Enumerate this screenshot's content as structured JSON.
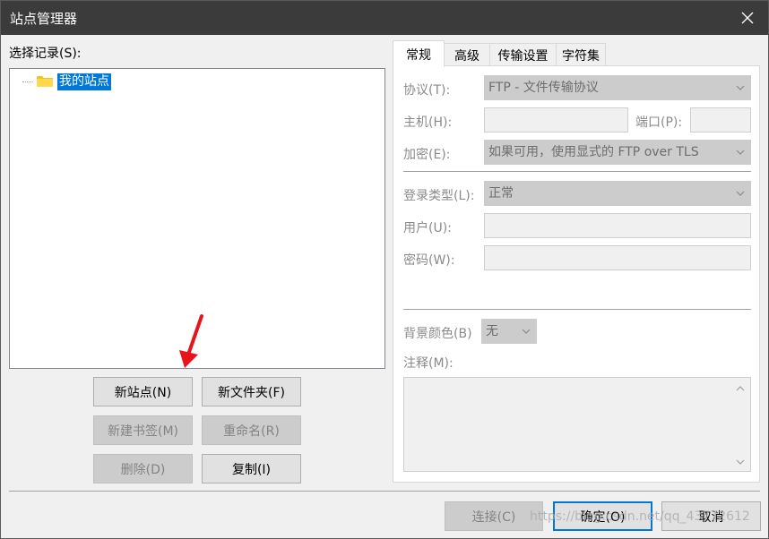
{
  "window": {
    "title": "站点管理器"
  },
  "tree": {
    "section_label": "选择记录(S):",
    "items": [
      {
        "label": "我的站点"
      }
    ]
  },
  "left_buttons": {
    "new_site": "新站点(N)",
    "new_folder": "新文件夹(F)",
    "new_bookmark": "新建书签(M)",
    "rename": "重命名(R)",
    "delete": "删除(D)",
    "duplicate": "复制(I)"
  },
  "tabs": [
    "常规",
    "高级",
    "传输设置",
    "字符集"
  ],
  "general": {
    "protocol_label": "协议(T):",
    "protocol_value": "FTP - 文件传输协议",
    "host_label": "主机(H):",
    "host_value": "",
    "port_label": "端口(P):",
    "port_value": "",
    "encryption_label": "加密(E):",
    "encryption_value": "如果可用，使用显式的 FTP over TLS",
    "logon_type_label": "登录类型(L):",
    "logon_type_value": "正常",
    "user_label": "用户(U):",
    "user_value": "",
    "password_label": "密码(W):",
    "password_value": "",
    "bg_color_label": "背景颜色(B)",
    "bg_color_value": "无",
    "comments_label": "注释(M):",
    "comments_value": ""
  },
  "bottom_buttons": {
    "connect": "连接(C)",
    "ok": "确定(O)",
    "cancel": "取消"
  },
  "watermark": "https://blog.csdn.net/qq_43772612",
  "colors": {
    "selection": "#0078d7",
    "titlebar": "#3b3b3b",
    "annotation_arrow": "#e8141b",
    "folder": "#f5c218"
  },
  "icons": [
    "close-icon",
    "folder-icon",
    "chevron-down-icon",
    "chevron-up-icon",
    "annotation-arrow-icon"
  ]
}
